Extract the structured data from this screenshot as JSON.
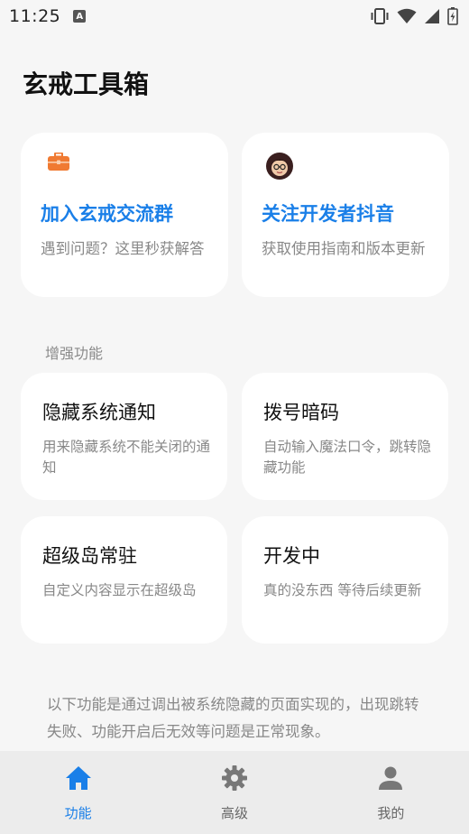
{
  "status_bar": {
    "time": "11:25",
    "notification_badge": "A",
    "icons": [
      "vibrate-icon",
      "wifi-icon",
      "signal-icon",
      "battery-icon"
    ]
  },
  "page": {
    "title": "玄戒工具箱"
  },
  "promo_cards": [
    {
      "icon": "toolbox-icon",
      "title": "加入玄戒交流群",
      "desc": "遇到问题？这里秒获解答"
    },
    {
      "icon": "developer-avatar-icon",
      "title": "关注开发者抖音",
      "desc": "获取使用指南和版本更新"
    }
  ],
  "section": {
    "label": "增强功能"
  },
  "features": [
    {
      "title": "隐藏系统通知",
      "desc": "用来隐藏系统不能关闭的通知"
    },
    {
      "title": "拨号暗码",
      "desc": "自动输入魔法口令，跳转隐藏功能"
    },
    {
      "title": "超级岛常驻",
      "desc": "自定义内容显示在超级岛"
    },
    {
      "title": "开发中",
      "desc": "真的没东西 等待后续更新"
    }
  ],
  "notice": {
    "text": "以下功能是通过调出被系统隐藏的页面实现的，出现跳转失败、功能开启后无效等问题是正常现象。"
  },
  "bottom_nav": {
    "items": [
      {
        "label": "功能",
        "icon": "home-icon",
        "active": true
      },
      {
        "label": "高级",
        "icon": "gear-icon",
        "active": false
      },
      {
        "label": "我的",
        "icon": "person-icon",
        "active": false
      }
    ]
  },
  "colors": {
    "accent": "#1a7fe8",
    "background": "#f6f6f6",
    "card": "#ffffff",
    "nav_background": "#ececec",
    "secondary_text": "#888888",
    "toolbox_orange": "#f07a32"
  }
}
